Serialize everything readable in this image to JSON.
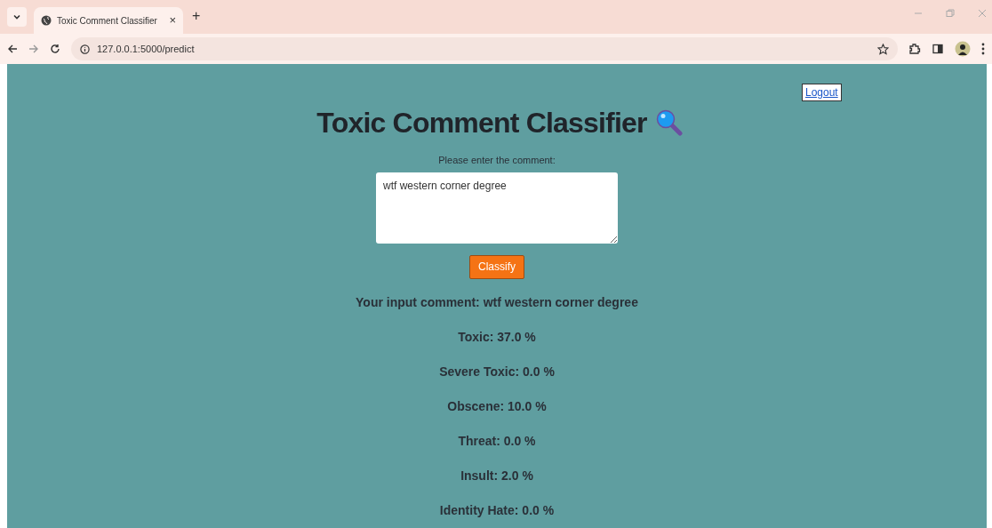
{
  "browser": {
    "tab_title": "Toxic Comment Classifier",
    "tab_close": "×",
    "new_tab": "+",
    "url": "127.0.0.1:5000/predict"
  },
  "page": {
    "logout": "Logout",
    "heading": "Toxic Comment Classifier",
    "prompt": "Please enter the comment:",
    "comment": "wtf western corner degree",
    "button": "Classify",
    "input_echo": "Your input comment: wtf western corner degree",
    "results": [
      {
        "text": "Toxic: 37.0 %"
      },
      {
        "text": "Severe Toxic: 0.0 %"
      },
      {
        "text": "Obscene: 10.0 %"
      },
      {
        "text": "Threat: 0.0 %"
      },
      {
        "text": "Insult: 2.0 %"
      },
      {
        "text": "Identity Hate: 0.0 %"
      }
    ]
  }
}
